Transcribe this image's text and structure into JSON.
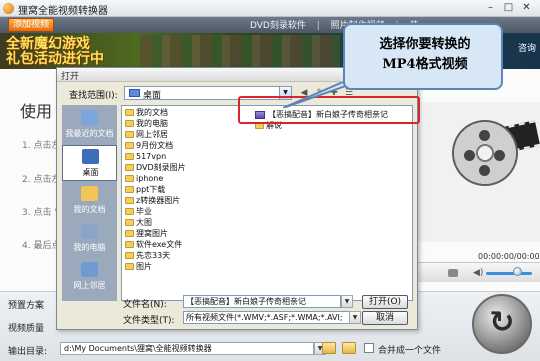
{
  "app": {
    "title": "狸窝全能视频转换器",
    "window_controls": [
      "–",
      "□",
      "✕"
    ]
  },
  "toolbar": {
    "add_video_label": "添加视频",
    "links": [
      "DVD刻录软件",
      "照片制作视频",
      "装"
    ]
  },
  "banner": {
    "text_line1": "全新魔幻游戏",
    "text_line2": "礼包活动进行中",
    "right_text": "咨询"
  },
  "main": {
    "heading": "使用",
    "steps": [
      "1. 点击左",
      "2. 点击左",
      "3. 点击 “",
      "4. 最后点"
    ]
  },
  "preview": {
    "timecode": "00:00:00/00:00:00"
  },
  "bottom": {
    "preset_label": "预置方案",
    "quality_label": "视频质量",
    "output_label": "输出目录:",
    "output_path": "d:\\My Documents\\狸窝\\全能视频转换器",
    "merge_label": "合并成一个文件",
    "merge_checked": false
  },
  "dialog": {
    "title": "打开",
    "look_in_label": "查找范围(I):",
    "look_in_value": "桌面",
    "places": [
      {
        "label": "我最近的文档",
        "icon": "recent-documents-icon",
        "color": "#7aa6dc"
      },
      {
        "label": "桌面",
        "icon": "desktop-icon",
        "color": "#3d6fb8"
      },
      {
        "label": "我的文档",
        "icon": "my-documents-icon",
        "color": "#f0c55a"
      },
      {
        "label": "我的电脑",
        "icon": "my-computer-icon",
        "color": "#8aa5c7"
      },
      {
        "label": "网上邻居",
        "icon": "network-places-icon",
        "color": "#6f9ad2"
      }
    ],
    "folders_col1": [
      "我的文档",
      "我的电脑",
      "网上邻居",
      "9月份文档",
      "517vpn",
      "DVD刻录图片",
      "iphone",
      "ppt下载",
      "z转换器图片",
      "毕业",
      "大图",
      "狸窝图片",
      "软件exe文件",
      "先恋33天",
      "图片"
    ],
    "files_col2": [
      "【恶搞配音】新白娘子传奇相亲记",
      "解说"
    ],
    "file_name_label": "文件名(N):",
    "file_name_value": "【恶搞配音】新白娘子传奇相亲记",
    "file_type_label": "文件类型(T):",
    "file_type_value": "所有视频文件(*.WMV;*.ASF;*.WMA;*.AVI;",
    "open_button": "打开(O)",
    "cancel_button": "取消"
  },
  "callout": {
    "line1": "选择你要转换的",
    "line2": "MP4格式视频"
  },
  "colors": {
    "highlight": "#d7262e",
    "callout_bg": "#d7e7f6",
    "callout_border": "#5b85b6",
    "add_video_btn": "#e06a12"
  }
}
